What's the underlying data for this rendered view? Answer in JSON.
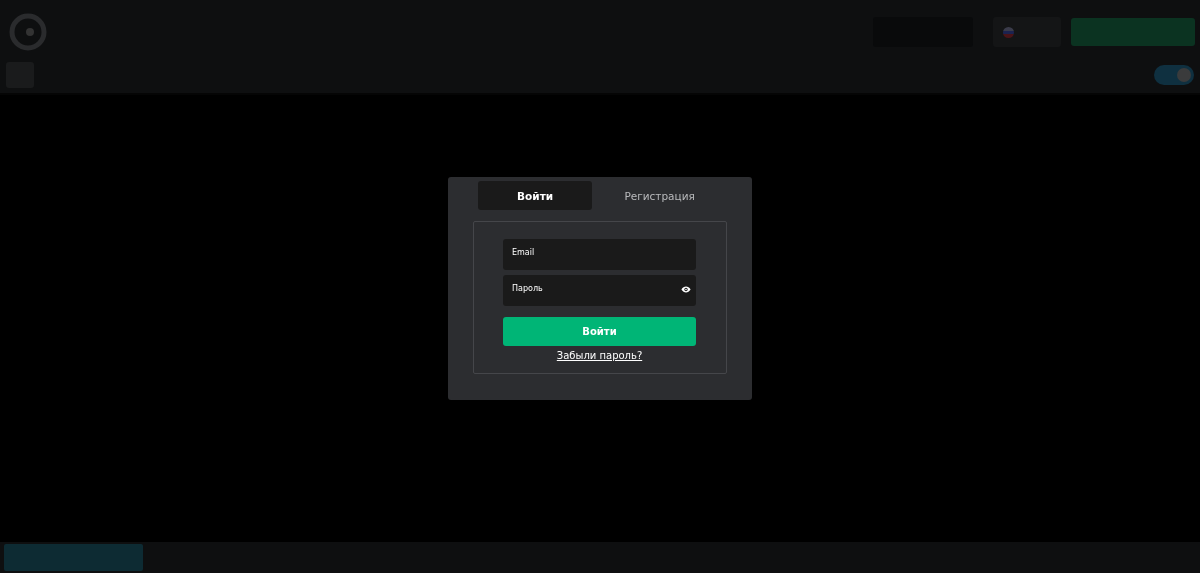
{
  "tabs": [
    {
      "label": "Войти",
      "selected": true
    },
    {
      "label": "Регистрация",
      "selected": false
    }
  ],
  "fields": [
    {
      "label": "Email",
      "kind": "text"
    },
    {
      "label": "Пароль",
      "kind": "password"
    }
  ],
  "submit": "Войти",
  "toggle": {
    "on": true
  },
  "forgot_link": "Забыли пароль?"
}
